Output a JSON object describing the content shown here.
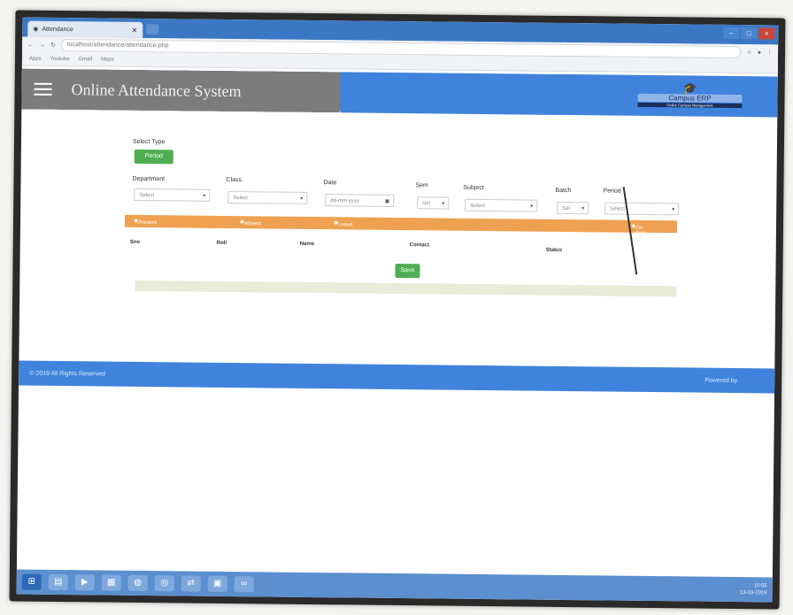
{
  "browser": {
    "tab_title": "Attendance",
    "url": "localhost/attendance/attendance.php",
    "bookmarks": [
      "Apps",
      "Youtube",
      "Gmail",
      "Maps"
    ],
    "window_controls": [
      "–",
      "□",
      "×"
    ]
  },
  "header": {
    "title": "Online Attendance System",
    "logo": {
      "name": "Campus ERP",
      "tagline": "Online Campus Management"
    }
  },
  "form": {
    "select_type_label": "Select Type",
    "type_button": "Period",
    "fields": [
      {
        "label": "Department",
        "value": "Select"
      },
      {
        "label": "Class",
        "value": "Select"
      },
      {
        "label": "Date",
        "value": "dd-mm-yyyy"
      },
      {
        "label": "Sem",
        "value": "Sel"
      },
      {
        "label": "Subject",
        "value": "Select"
      },
      {
        "label": "Batch",
        "value": "Sel"
      },
      {
        "label": "Period",
        "value": "Select"
      }
    ],
    "status_options": [
      "Present",
      "Absent",
      "Leave",
      "On Duty"
    ],
    "table_headers": [
      "Sno",
      "Roll",
      "Name",
      "Contact",
      "Status"
    ],
    "save_button": "Save"
  },
  "footer": {
    "copyright": "© 2019 All Rights Reserved",
    "credit": "Powered by"
  },
  "taskbar": {
    "time": "10:55",
    "date": "13-03-2019"
  },
  "colors": {
    "header_gray": "#7c7c7c",
    "header_blue": "#3f83dd",
    "accent_orange": "#eea150",
    "button_green": "#4fae52"
  }
}
